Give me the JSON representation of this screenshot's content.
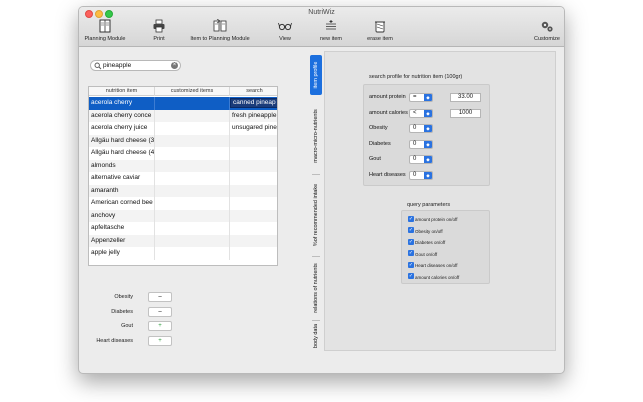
{
  "window": {
    "title": "NutriWiz"
  },
  "toolbar": {
    "items": [
      {
        "label": "Planning Module",
        "icon": "planning-module-icon"
      },
      {
        "label": "Print",
        "icon": "print-icon"
      },
      {
        "label": "Item to Planning Module",
        "icon": "item-to-planning-icon"
      },
      {
        "label": "View",
        "icon": "glasses-icon"
      },
      {
        "label": "new item",
        "icon": "new-item-icon"
      },
      {
        "label": "erase item",
        "icon": "trash-icon"
      },
      {
        "label": "Customize",
        "icon": "gears-icon"
      }
    ]
  },
  "search": {
    "value": "pineapple",
    "clear_glyph": "×"
  },
  "table": {
    "columns": [
      "nutrition item",
      "customized items",
      "search"
    ],
    "rows": [
      {
        "name": "acerola cherry",
        "custom": "",
        "search": "canned pineap",
        "selected": true
      },
      {
        "name": "acerola cherry conce",
        "custom": "",
        "search": "fresh pineapple"
      },
      {
        "name": "acerola cherry juice",
        "custom": "",
        "search": "unsugared pine"
      },
      {
        "name": "Allgäu hard cheese (3",
        "custom": "",
        "search": ""
      },
      {
        "name": "Allgäu hard cheese (4",
        "custom": "",
        "search": ""
      },
      {
        "name": "almonds",
        "custom": "",
        "search": ""
      },
      {
        "name": "alternative caviar",
        "custom": "",
        "search": ""
      },
      {
        "name": "amaranth",
        "custom": "",
        "search": ""
      },
      {
        "name": "American corned bee",
        "custom": "",
        "search": ""
      },
      {
        "name": "anchovy",
        "custom": "",
        "search": ""
      },
      {
        "name": "apfeltasche",
        "custom": "",
        "search": ""
      },
      {
        "name": "Appenzeller",
        "custom": "",
        "search": ""
      },
      {
        "name": "apple jelly",
        "custom": "",
        "search": ""
      }
    ]
  },
  "indicators": [
    {
      "label": "Obesity",
      "value": "–"
    },
    {
      "label": "Diabetes",
      "value": "–"
    },
    {
      "label": "Gout",
      "value": "+"
    },
    {
      "label": "Heart diseases",
      "value": "+"
    }
  ],
  "tabs": [
    {
      "label": "item profile",
      "active": true
    },
    {
      "label": "macro-micro-nutrients"
    },
    {
      "label": "%of recommended intake"
    },
    {
      "label": "relations of nutrients"
    },
    {
      "label": "body data"
    }
  ],
  "search_profile": {
    "title": "search profile for nutrition item (100gr)",
    "fields": [
      {
        "label": "amount protein",
        "op": "=",
        "value": "33.00"
      },
      {
        "label": "amount calories",
        "op": "<",
        "value": "1000"
      },
      {
        "label": "Obesity",
        "op": "0"
      },
      {
        "label": "Diabetes",
        "op": "0"
      },
      {
        "label": "Gout",
        "op": "0"
      },
      {
        "label": "Heart diseases",
        "op": "0"
      }
    ]
  },
  "query_parameters": {
    "title": "query parameters",
    "items": [
      "amount protein on/off",
      "Obesity on/off",
      "Diabetes on/off",
      "Gout on/off",
      "Heart diseases on/off",
      "amount calories on/off"
    ]
  },
  "colors": {
    "accent": "#1c6fde",
    "selection": "#0f5ec5",
    "close": "#fc605c",
    "minimize": "#fdbc40",
    "maximize": "#34c84a"
  }
}
